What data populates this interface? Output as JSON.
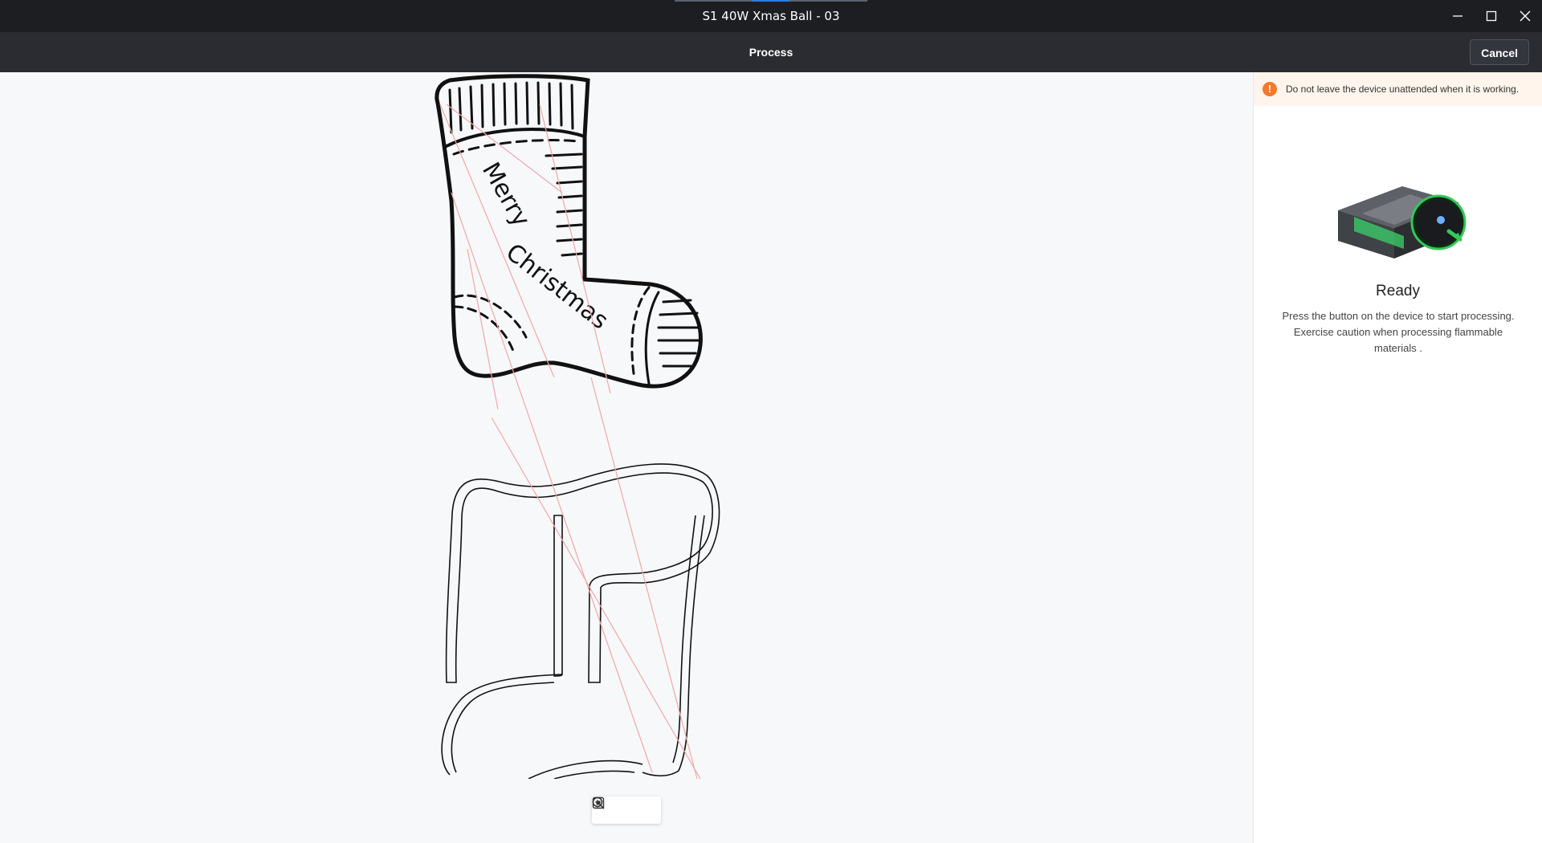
{
  "window": {
    "title": "S1 40W Xmas Ball - 03",
    "controls": {
      "minimize": "minimize-icon",
      "maximize": "maximize-icon",
      "close": "close-icon"
    }
  },
  "toolbar": {
    "title": "Process",
    "cancel_label": "Cancel"
  },
  "canvas": {
    "engraving_text": "Merry Christmas",
    "zoom_controls": [
      "zoom-out-icon",
      "zoom-in-icon",
      "fit-screen-icon"
    ]
  },
  "panel": {
    "warning": "Do not leave the device unattended when it is working.",
    "status": {
      "title": "Ready",
      "description": "Press the button on the device to start processing. Exercise caution when processing flammable materials ."
    }
  },
  "colors": {
    "titlebar": "#1c1e22",
    "toolbar": "#2a2c31",
    "warning_icon": "#f5792a",
    "device_accent": "#36c75a",
    "path_line": "#f0a8a8"
  }
}
